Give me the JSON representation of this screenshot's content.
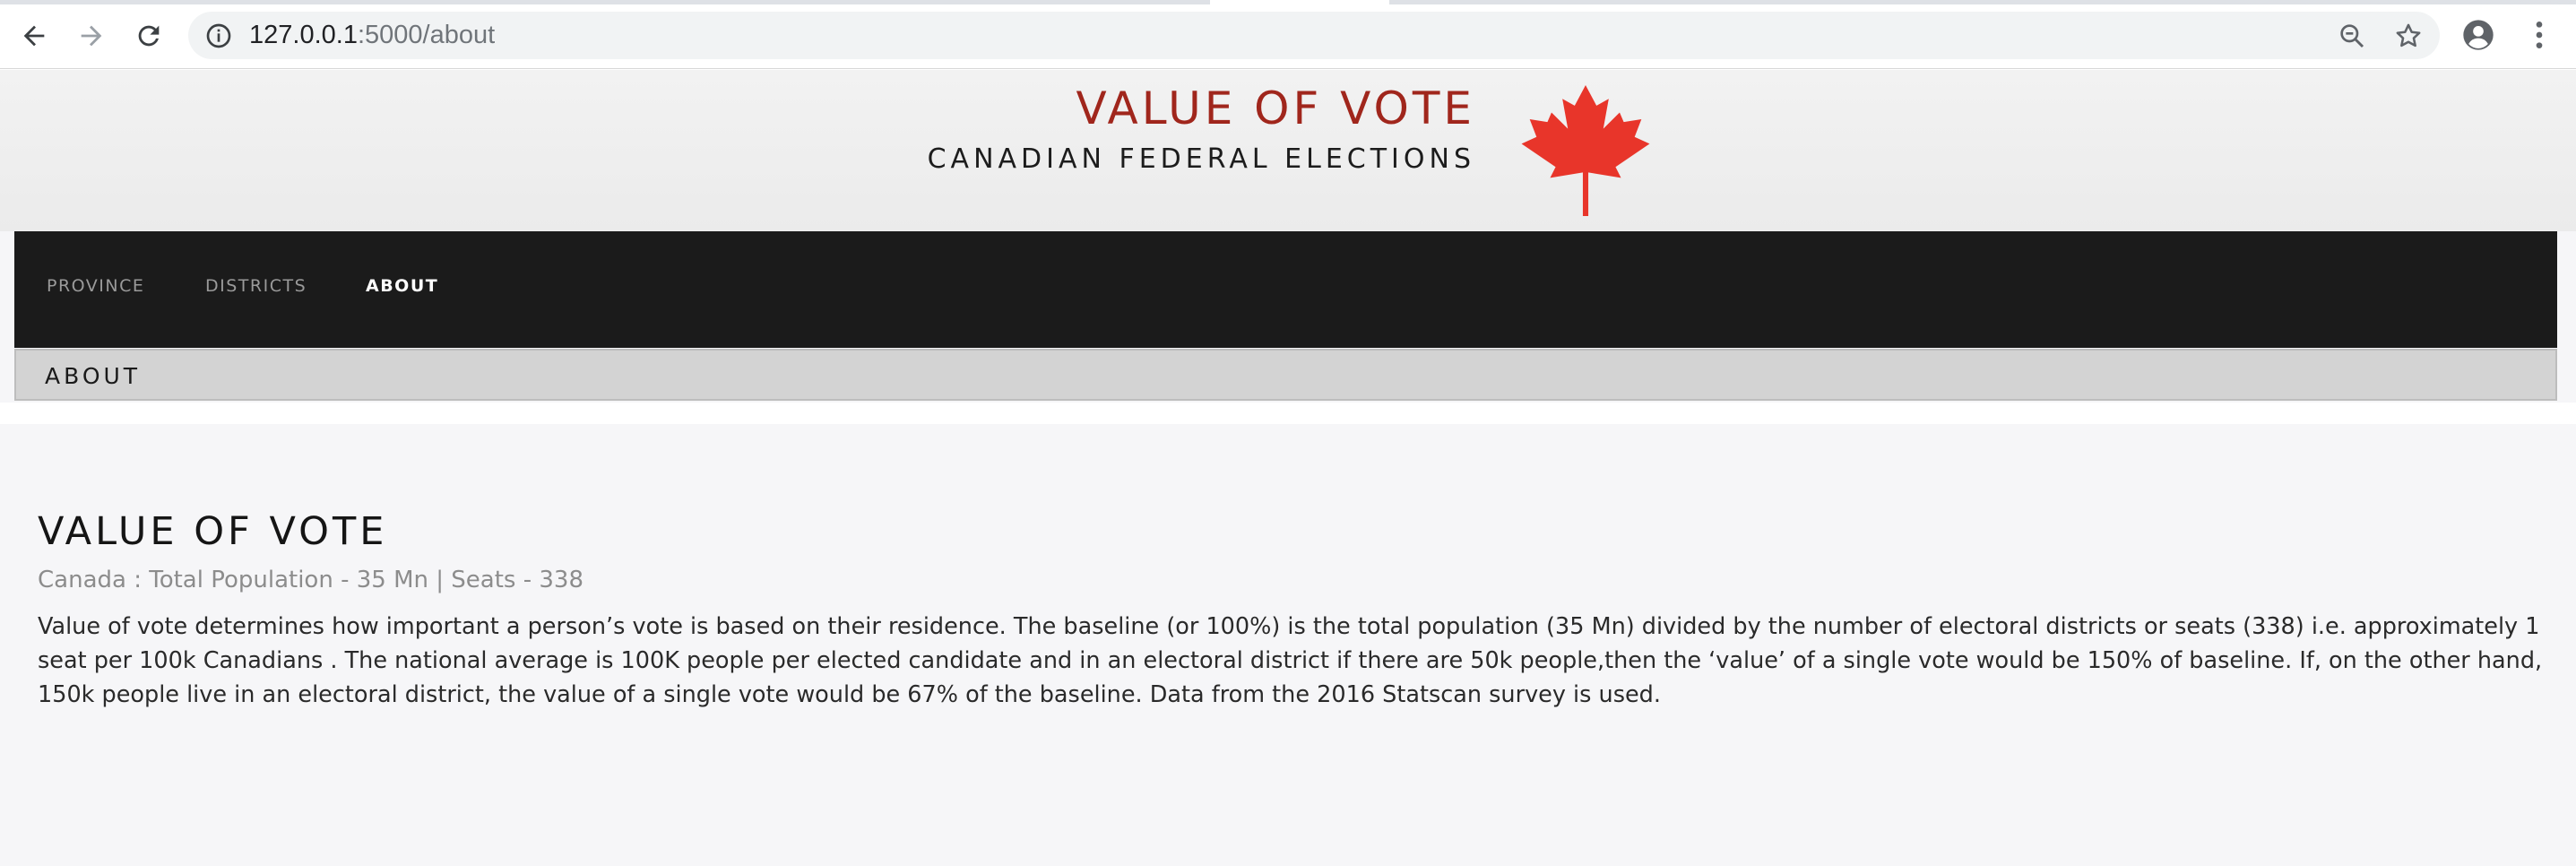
{
  "browser": {
    "url_host": "127.0.0.1",
    "url_rest": ":5000/about",
    "icons": [
      "back-arrow-icon",
      "forward-arrow-icon",
      "reload-icon",
      "info-icon",
      "zoom-icon",
      "star-icon",
      "profile-icon",
      "menu-dots-icon"
    ]
  },
  "site": {
    "title": "VALUE OF VOTE",
    "subtitle": "CANADIAN FEDERAL ELECTIONS",
    "logo_icon": "maple-leaf-icon",
    "colors": {
      "title": "#a0261c",
      "leaf": "#e8352a",
      "navbar": "#1b1b1b"
    }
  },
  "nav": {
    "items": [
      {
        "label": "PROVINCE",
        "active": false
      },
      {
        "label": "DISTRICTS",
        "active": false
      },
      {
        "label": "ABOUT",
        "active": true
      }
    ]
  },
  "subbar": {
    "label": "ABOUT"
  },
  "content": {
    "heading": "VALUE OF VOTE",
    "meta": "Canada : Total Population - 35 Mn | Seats - 338",
    "paragraph": "Value of vote determines how important a person’s vote is based on their residence. The baseline (or 100%) is the total population (35 Mn) divided by the number of electoral districts or seats (338) i.e. approximately 1 seat per 100k Canadians . The national average is 100K people per elected candidate and in an electoral district if there are 50k people,then the ‘value’ of a single vote would be 150% of baseline. If, on the other hand, 150k people live in an electoral district, the value of a single vote would be 67% of the baseline. Data from the 2016 Statscan survey is used."
  }
}
